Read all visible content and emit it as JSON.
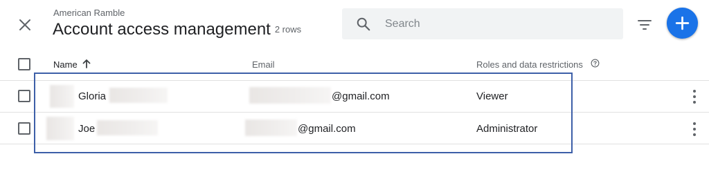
{
  "header": {
    "account_name": "American Ramble",
    "title": "Account access management",
    "row_count": "2 rows"
  },
  "search": {
    "placeholder": "Search",
    "value": ""
  },
  "icons": {
    "close": "close-icon",
    "search": "search-icon",
    "filter": "filter-icon",
    "add": "plus-icon",
    "sort": "arrow-up-icon",
    "help": "help-circle-icon",
    "more": "more-vertical-icon"
  },
  "colors": {
    "accent": "#1a73e8",
    "highlight_border": "#3d5fa8"
  },
  "table": {
    "columns": [
      {
        "label": "Name"
      },
      {
        "label": "Email"
      },
      {
        "label": "Roles and data restrictions"
      }
    ],
    "rows": [
      {
        "name": "Gloria",
        "email": "@gmail.com",
        "role": "Viewer"
      },
      {
        "name": "Joe",
        "email": "@gmail.com",
        "role": "Administrator"
      }
    ]
  }
}
